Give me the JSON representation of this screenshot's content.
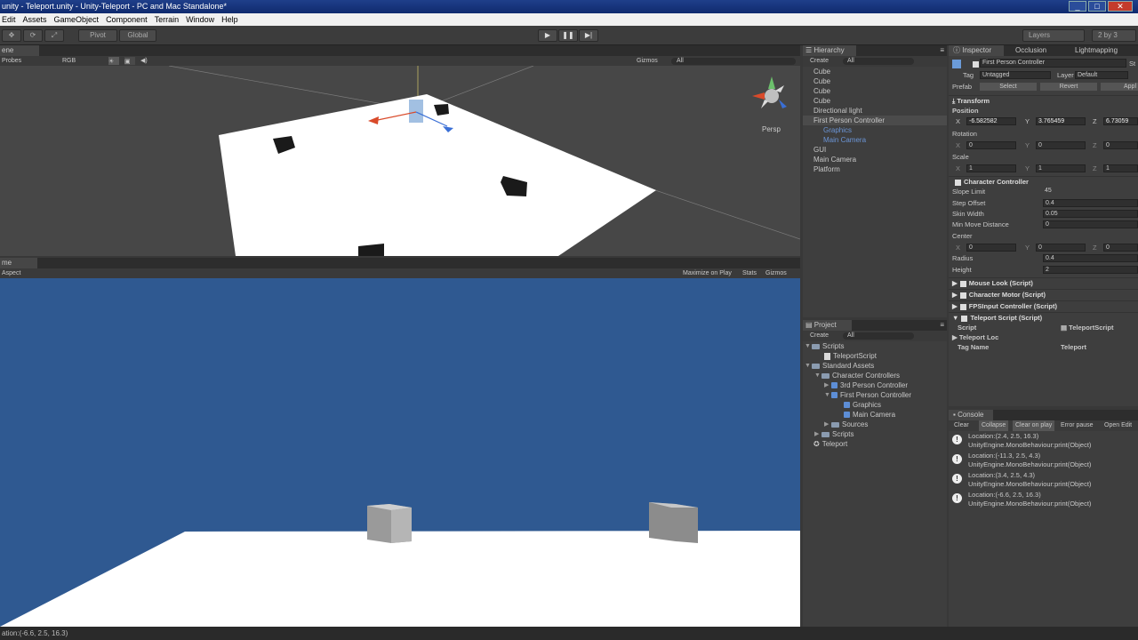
{
  "window": {
    "title": "unity - Teleport.unity - Unity-Teleport - PC and Mac Standalone*"
  },
  "menu": [
    "Edit",
    "Assets",
    "GameObject",
    "Component",
    "Terrain",
    "Window",
    "Help"
  ],
  "toolbar": {
    "pivot": "Pivot",
    "global": "Global",
    "layers": "Layers",
    "layout": "2 by 3"
  },
  "scene": {
    "tab": "ene",
    "draw_mode": "Probes",
    "render_mode": "RGB",
    "gizmos": "Gizmos",
    "search": "All",
    "persp": "Persp"
  },
  "game": {
    "tab": "me",
    "aspect": "Aspect",
    "maximize": "Maximize on Play",
    "stats": "Stats",
    "gizmos": "Gizmos"
  },
  "hierarchy": {
    "tab": "Hierarchy",
    "create": "Create",
    "search": "All",
    "items": [
      {
        "label": "Cube",
        "level": 0
      },
      {
        "label": "Cube",
        "level": 0
      },
      {
        "label": "Cube",
        "level": 0
      },
      {
        "label": "Cube",
        "level": 0
      },
      {
        "label": "Directional light",
        "level": 0
      },
      {
        "label": "First Person Controller",
        "level": 0
      },
      {
        "label": "Graphics",
        "level": 1
      },
      {
        "label": "Main Camera",
        "level": 1
      },
      {
        "label": "GUI",
        "level": 0
      },
      {
        "label": "Main Camera",
        "level": 0
      },
      {
        "label": "Platform",
        "level": 0
      }
    ]
  },
  "project": {
    "tab": "Project",
    "create": "Create",
    "search": "All",
    "items": [
      {
        "label": "Scripts",
        "icon": "folder",
        "indent": 0
      },
      {
        "label": "TeleportScript",
        "icon": "script",
        "indent": 1
      },
      {
        "label": "Standard Assets",
        "icon": "folder",
        "indent": 0
      },
      {
        "label": "Character Controllers",
        "icon": "folder",
        "indent": 1
      },
      {
        "label": "3rd Person Controller",
        "icon": "prefab",
        "indent": 2
      },
      {
        "label": "First Person Controller",
        "icon": "prefab",
        "indent": 2
      },
      {
        "label": "Graphics",
        "icon": "prefab",
        "indent": 3
      },
      {
        "label": "Main Camera",
        "icon": "prefab",
        "indent": 3
      },
      {
        "label": "Sources",
        "icon": "folder",
        "indent": 2
      },
      {
        "label": "Scripts",
        "icon": "folder",
        "indent": 1
      },
      {
        "label": "Teleport",
        "icon": "unity",
        "indent": 0
      }
    ]
  },
  "inspector": {
    "tabs": [
      "Inspector",
      "Occlusion",
      "Lightmapping"
    ],
    "object_name": "First Person Controller",
    "static": "St",
    "tag_label": "Tag",
    "tag": "Untagged",
    "layer_label": "Layer",
    "layer": "Default",
    "prefab_label": "Prefab",
    "select": "Select",
    "revert": "Revert",
    "apply": "Appl",
    "transform": "Transform",
    "position_label": "Position",
    "position": {
      "x": "-6.582582",
      "y": "3.765459",
      "z": "6.73059"
    },
    "rotation_label": "Rotation",
    "rotation": {
      "x": "0",
      "y": "0",
      "z": "0"
    },
    "scale_label": "Scale",
    "scale": {
      "x": "1",
      "y": "1",
      "z": "1"
    },
    "character_controller": "Character Controller",
    "cc_fields": [
      {
        "label": "Slope Limit",
        "value": "45"
      },
      {
        "label": "Step Offset",
        "value": "0.4"
      },
      {
        "label": "Skin Width",
        "value": "0.05"
      },
      {
        "label": "Min Move Distance",
        "value": "0"
      }
    ],
    "center_label": "Center",
    "center": {
      "x": "0",
      "y": "0",
      "z": "0"
    },
    "radius_label": "Radius",
    "radius": "0.4",
    "height_label": "Height",
    "height": "2",
    "scripts": [
      "Mouse Look (Script)",
      "Character Motor (Script)",
      "FPSInput Controller (Script)",
      "Teleport Script (Script)"
    ],
    "script_label": "Script",
    "script_value": "TeleportScript",
    "teleport_loc_label": "Teleport Loc",
    "tag_name_label": "Tag Name",
    "tag_name_value": "Teleport"
  },
  "console": {
    "tab": "Console",
    "buttons": [
      "Clear",
      "Collapse",
      "Clear on play",
      "Error pause",
      "Open Edit"
    ],
    "entries": [
      {
        "line1": "Location:(2.4, 2.5, 16.3)",
        "line2": "UnityEngine.MonoBehaviour:print(Object)"
      },
      {
        "line1": "Location:(-11.3, 2.5, 4.3)",
        "line2": "UnityEngine.MonoBehaviour:print(Object)"
      },
      {
        "line1": "Location:(3.4, 2.5, 4.3)",
        "line2": "UnityEngine.MonoBehaviour:print(Object)"
      },
      {
        "line1": "Location:(-6.6, 2.5, 16.3)",
        "line2": "UnityEngine.MonoBehaviour:print(Object)"
      }
    ]
  },
  "status": {
    "text": "ation:(-6.6, 2.5, 16.3)"
  }
}
